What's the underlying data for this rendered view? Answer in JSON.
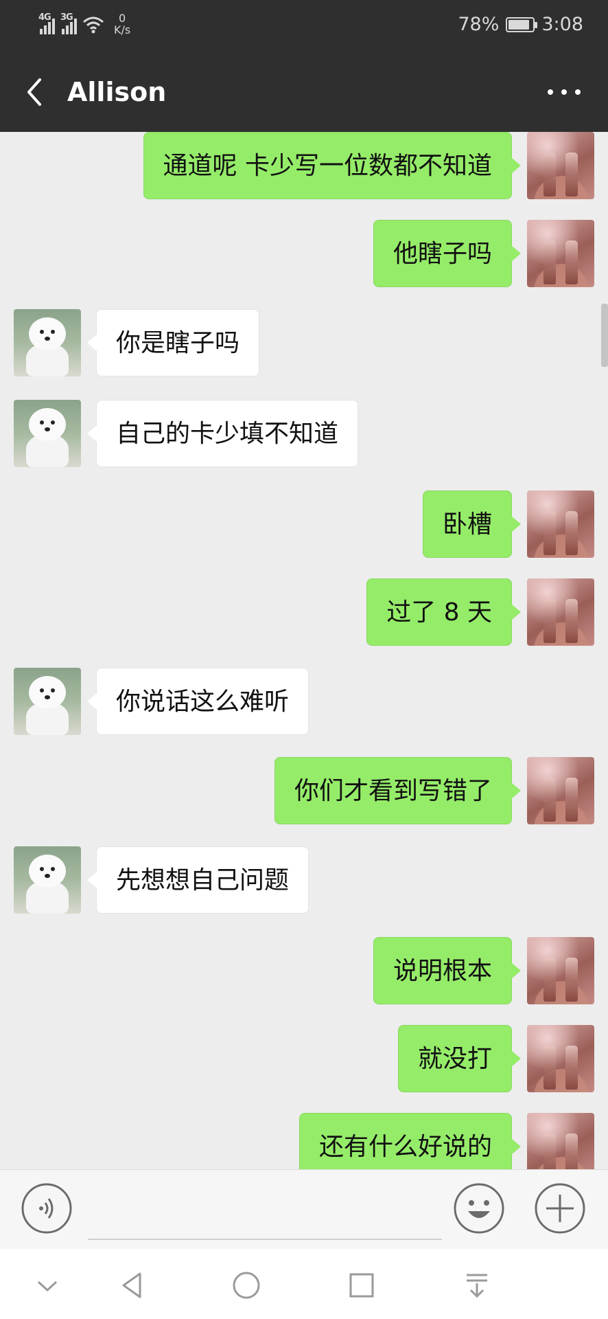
{
  "status_bar": {
    "network_1": "4G",
    "network_2": "3G",
    "speed_value": "0",
    "speed_unit": "K/s",
    "battery": "78%",
    "time": "3:08"
  },
  "header": {
    "title": "Allison"
  },
  "messages": [
    {
      "sender": "me",
      "text": "通道呢  卡少写一位数都不知道"
    },
    {
      "sender": "me",
      "text": "他瞎子吗"
    },
    {
      "sender": "other",
      "text": "你是瞎子吗"
    },
    {
      "sender": "other",
      "text": "自己的卡少填不知道"
    },
    {
      "sender": "me",
      "text": "卧槽"
    },
    {
      "sender": "me",
      "text": "过了 8 天"
    },
    {
      "sender": "other",
      "text": "你说话这么难听"
    },
    {
      "sender": "me",
      "text": "你们才看到写错了"
    },
    {
      "sender": "other",
      "text": "先想想自己问题"
    },
    {
      "sender": "me",
      "text": "说明根本"
    },
    {
      "sender": "me",
      "text": "就没打"
    },
    {
      "sender": "me",
      "text": "还有什么好说的"
    }
  ],
  "input_bar": {
    "text_value": ""
  },
  "icons": {
    "back": "chevron-left-icon",
    "more": "more-dots-icon",
    "voice": "voice-icon",
    "emoji": "emoji-icon",
    "plus": "plus-icon",
    "nav": [
      "chevron-down-icon",
      "back-triangle-icon",
      "home-circle-icon",
      "recents-square-icon",
      "notification-pull-icon"
    ]
  },
  "colors": {
    "header_bg": "#2f2f2f",
    "chat_bg": "#ededed",
    "my_bubble": "#95ec69",
    "their_bubble": "#ffffff"
  }
}
